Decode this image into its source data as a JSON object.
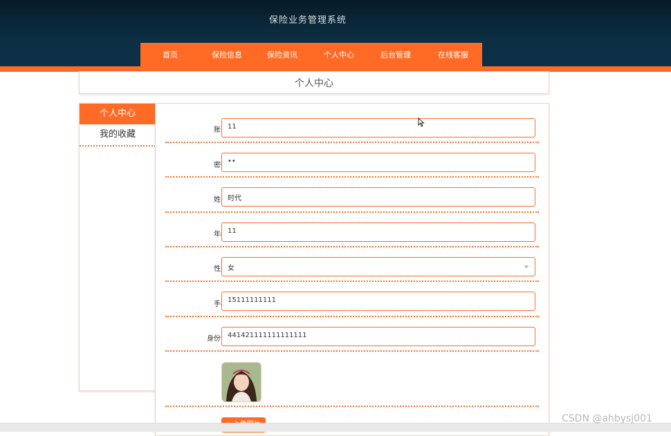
{
  "site": {
    "title": "保险业务管理系统"
  },
  "nav": {
    "items": [
      "首页",
      "保险信息",
      "保险资讯",
      "个人中心",
      "后台管理",
      "在线客服"
    ]
  },
  "page": {
    "title": "个人中心"
  },
  "sidebar": {
    "items": [
      {
        "label": "个人中心",
        "active": true
      },
      {
        "label": "我的收藏",
        "active": false
      }
    ]
  },
  "form": {
    "fields": [
      {
        "label": "账号",
        "value": "11"
      },
      {
        "label": "密码",
        "value": "••"
      },
      {
        "label": "姓名",
        "value": "时代"
      },
      {
        "label": "年龄",
        "value": "11"
      },
      {
        "label": "性别",
        "value": "女",
        "type": "select"
      },
      {
        "label": "手机",
        "value": "15111111111"
      },
      {
        "label": "身份证",
        "value": "441421111111111111"
      }
    ],
    "upload_label": "上传图片"
  },
  "watermark": "CSDN @ahbysj001",
  "colors": {
    "accent": "#ff6a24",
    "header": "#0c2f44"
  }
}
